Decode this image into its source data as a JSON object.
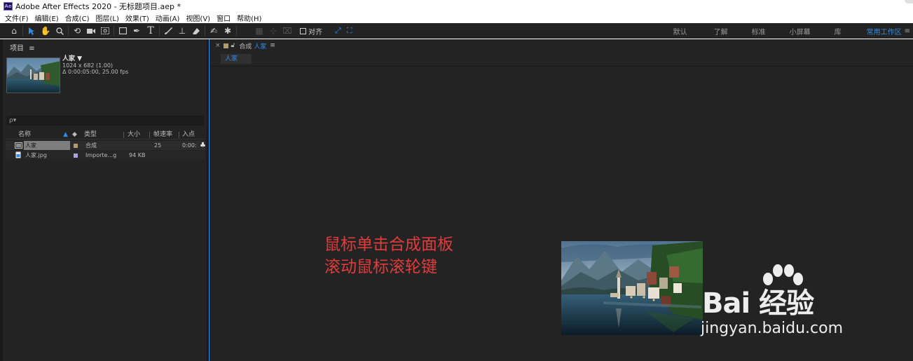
{
  "window": {
    "app_icon": "Ae",
    "title": "Adobe After Effects 2020 - 无标题项目.aep *"
  },
  "menu": [
    "文件(F)",
    "编辑(E)",
    "合成(C)",
    "图层(L)",
    "效果(T)",
    "动画(A)",
    "视图(V)",
    "窗口",
    "帮助(H)"
  ],
  "toolbar": {
    "tools": [
      "home-icon",
      "selection-arrow-icon",
      "hand-icon",
      "zoom-icon",
      "rotate-icon",
      "camera-icon",
      "pan-behind-icon",
      "rectangle-icon",
      "pen-icon",
      "text-icon",
      "brush-icon",
      "clone-stamp-icon",
      "eraser-icon",
      "roto-brush-icon",
      "puppet-pin-icon"
    ],
    "snap_label": "对齐",
    "workspaces": [
      "默认",
      "了解",
      "标准",
      "小屏幕",
      "库",
      "常用工作区"
    ],
    "active_workspace": "常用工作区",
    "menu_icon": "≡"
  },
  "project_panel": {
    "title": "项目",
    "menu_icon": "≡",
    "selected_item": {
      "name": "人家 ▼",
      "size": "1024 x 682 (1.00)",
      "duration": "Δ 0:00:05:00, 25.00 fps"
    },
    "search_placeholder": "ρ▾",
    "columns": [
      "名称",
      "类型",
      "大小",
      "帧速率",
      "入点"
    ],
    "items": [
      {
        "name": "人家",
        "type": "合成",
        "size": "",
        "fps": "25",
        "in_point": "0:00:",
        "label_color": "#b39b6c",
        "icon": "composition-icon"
      },
      {
        "name": "人家.jpg",
        "type": "Importe...g",
        "size": "94 KB",
        "fps": "",
        "in_point": "",
        "label_color": "#a9a2e0",
        "icon": "image-file-icon"
      }
    ]
  },
  "comp_panel": {
    "tab_label": "合成",
    "tab_comp_name": "人家",
    "menu_icon": "≡",
    "breadcrumb": "人家",
    "annotation_lines": [
      "鼠标单击合成面板",
      "滚动鼠标滚轮键"
    ]
  },
  "watermark": {
    "main": "Bai 经验",
    "sub": "jingyan.baidu.com"
  },
  "colors": {
    "accent": "#2d8ceb",
    "panel_bg": "#232323",
    "annotation": "#e23b3b"
  }
}
